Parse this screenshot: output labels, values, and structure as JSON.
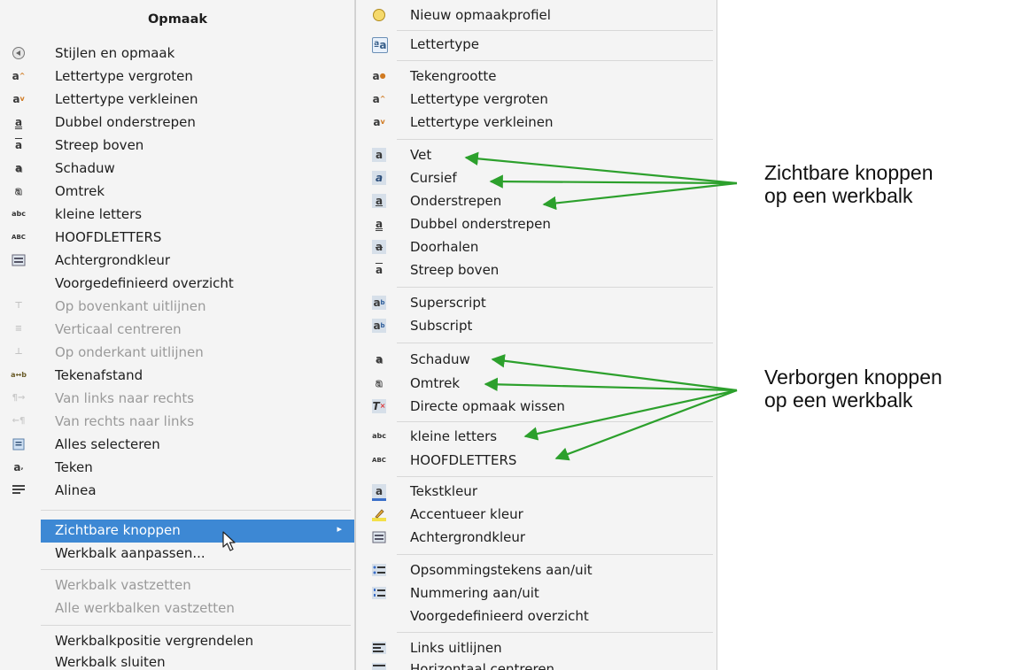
{
  "left_menu": {
    "title": "Opmaak",
    "items": [
      {
        "label": "Stijlen en opmaak",
        "icon": "styles-icon",
        "disabled": false
      },
      {
        "label": "Lettertype vergroten",
        "icon": "font-grow-icon",
        "disabled": false
      },
      {
        "label": "Lettertype verkleinen",
        "icon": "font-shrink-icon",
        "disabled": false
      },
      {
        "label": "Dubbel onderstrepen",
        "icon": "double-underline-icon",
        "disabled": false
      },
      {
        "label": "Streep boven",
        "icon": "overline-icon",
        "disabled": false
      },
      {
        "label": "Schaduw",
        "icon": "shadow-icon",
        "disabled": false
      },
      {
        "label": "Omtrek",
        "icon": "outline-icon",
        "disabled": false
      },
      {
        "label": "kleine letters",
        "icon": "lowercase-icon",
        "disabled": false
      },
      {
        "label": "HOOFDLETTERS",
        "icon": "uppercase-icon",
        "disabled": false
      },
      {
        "label": "Achtergrondkleur",
        "icon": "background-color-icon",
        "disabled": false
      },
      {
        "label": "Voorgedefinieerd overzicht",
        "icon": "",
        "disabled": false
      },
      {
        "label": "Op bovenkant uitlijnen",
        "icon": "align-top-icon",
        "disabled": true
      },
      {
        "label": "Verticaal centreren",
        "icon": "align-vcenter-icon",
        "disabled": true
      },
      {
        "label": "Op onderkant uitlijnen",
        "icon": "align-bottom-icon",
        "disabled": true
      },
      {
        "label": "Tekenafstand",
        "icon": "character-spacing-icon",
        "disabled": false
      },
      {
        "label": "Van links naar rechts",
        "icon": "ltr-icon",
        "disabled": true
      },
      {
        "label": "Van rechts naar links",
        "icon": "rtl-icon",
        "disabled": true
      },
      {
        "label": "Alles selecteren",
        "icon": "select-all-icon",
        "disabled": false
      },
      {
        "label": "Teken",
        "icon": "character-icon",
        "disabled": false
      },
      {
        "label": "Alinea",
        "icon": "paragraph-icon",
        "disabled": false
      }
    ],
    "toolbar_items": [
      {
        "label": "Zichtbare knoppen",
        "disabled": false,
        "highlighted": true,
        "submenu": true
      },
      {
        "label": "Werkbalk aanpassen...",
        "disabled": false
      },
      {
        "label": "Werkbalk vastzetten",
        "disabled": true
      },
      {
        "label": "Alle werkbalken vastzetten",
        "disabled": true
      },
      {
        "label": "Werkbalkpositie vergrendelen",
        "disabled": false
      },
      {
        "label": "Werkbalk sluiten",
        "disabled": false
      }
    ],
    "submenu_arrow": "▸"
  },
  "right_menu": {
    "items": [
      {
        "label": "Nieuw opmaakprofiel",
        "icon": "new-style-icon"
      },
      {
        "label": "Lettertype",
        "icon": "font-name-icon"
      },
      {
        "label": "Tekengrootte",
        "icon": "font-size-icon"
      },
      {
        "label": "Lettertype vergroten",
        "icon": "font-grow-icon"
      },
      {
        "label": "Lettertype verkleinen",
        "icon": "font-shrink-icon"
      },
      {
        "label": "Vet",
        "icon": "bold-icon"
      },
      {
        "label": "Cursief",
        "icon": "italic-icon"
      },
      {
        "label": "Onderstrepen",
        "icon": "underline-icon"
      },
      {
        "label": "Dubbel onderstrepen",
        "icon": "double-underline-icon"
      },
      {
        "label": "Doorhalen",
        "icon": "strikethrough-icon"
      },
      {
        "label": "Streep boven",
        "icon": "overline-icon"
      },
      {
        "label": "Superscript",
        "icon": "superscript-icon"
      },
      {
        "label": "Subscript",
        "icon": "subscript-icon"
      },
      {
        "label": "Schaduw",
        "icon": "shadow-icon"
      },
      {
        "label": "Omtrek",
        "icon": "outline-icon"
      },
      {
        "label": "Directe opmaak wissen",
        "icon": "clear-formatting-icon"
      },
      {
        "label": "kleine letters",
        "icon": "lowercase-icon"
      },
      {
        "label": "HOOFDLETTERS",
        "icon": "uppercase-icon"
      },
      {
        "label": "Tekstkleur",
        "icon": "font-color-icon"
      },
      {
        "label": "Accentueer kleur",
        "icon": "highlight-color-icon"
      },
      {
        "label": "Achtergrondkleur",
        "icon": "background-color-icon"
      },
      {
        "label": "Opsommingstekens aan/uit",
        "icon": "bullets-icon"
      },
      {
        "label": "Nummering aan/uit",
        "icon": "numbering-icon"
      },
      {
        "label": "Voorgedefinieerd overzicht",
        "icon": ""
      },
      {
        "label": "Links uitlijnen",
        "icon": "align-left-icon"
      },
      {
        "label": "Horizontaal centreren",
        "icon": "align-center-icon"
      }
    ]
  },
  "annotations": {
    "visible": [
      "Zichtbare knoppen",
      "op een werkbalk"
    ],
    "hidden": [
      "Verborgen knoppen",
      "op een werkbalk"
    ]
  },
  "colors": {
    "highlight": "#3d88d4",
    "arrow": "#2ca02c",
    "menu_bg": "#f4f4f4",
    "disabled_text": "#9a9a9a"
  }
}
